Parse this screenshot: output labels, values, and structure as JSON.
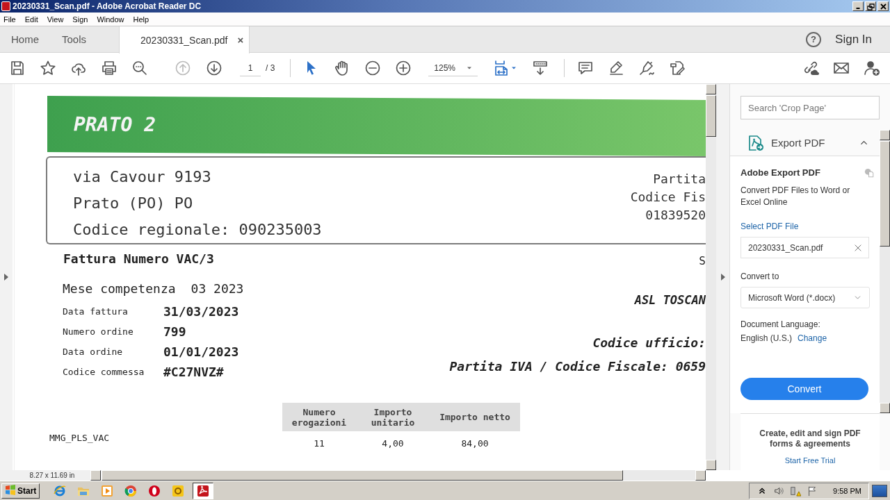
{
  "window": {
    "title": "20230331_Scan.pdf - Adobe Acrobat Reader DC"
  },
  "menu": [
    {
      "label": "File"
    },
    {
      "label": "Edit"
    },
    {
      "label": "View"
    },
    {
      "label": "Sign"
    },
    {
      "label": "Window"
    },
    {
      "label": "Help"
    }
  ],
  "tabs": [
    {
      "label": "Home",
      "selected": false
    },
    {
      "label": "Tools",
      "selected": false
    },
    {
      "label": "20230331_Scan.pdf",
      "selected": true,
      "close": "×"
    }
  ],
  "header_actions": {
    "help": "?",
    "sign_in": "Sign In"
  },
  "toolbar": {
    "navigation": [
      {
        "kind": "previous",
        "disabled": true
      },
      {
        "kind": "next",
        "disabled": false
      }
    ],
    "page_current": "1",
    "page_total": "/ 3",
    "pointer_tools": [
      {
        "kind": "select",
        "selected": true
      },
      {
        "kind": "hand",
        "selected": false
      }
    ],
    "zoom": "125%"
  },
  "document": {
    "header": "PRATO 2",
    "address_lines": [
      "via Cavour 9193",
      "Prato (PO) PO",
      "Codice regionale: 090235003"
    ],
    "right_lines": [
      "Partita",
      "Codice Fis",
      "01839520"
    ],
    "invoice": "Fattura Numero VAC/3",
    "invoice_right": "S",
    "period_label": "Mese competenza",
    "period_value": "03 2023",
    "recipient": "ASL TOSCAN",
    "details": [
      {
        "label": "Data fattura",
        "value": "31/03/2023"
      },
      {
        "label": "Numero ordine",
        "value": "799"
      },
      {
        "label": "Data ordine",
        "value": "01/01/2023"
      },
      {
        "label": "Codice commessa",
        "value": "#C27NVZ#"
      }
    ],
    "right_details": [
      "Codice ufficio:",
      "Partita IVA / Codice Fiscale: 0659"
    ],
    "table": {
      "columns": [
        "Numero erogazioni",
        "Importo unitario",
        "Importo netto"
      ],
      "rows": [
        {
          "service": "MMG_PLS_VAC",
          "cells": [
            "11",
            "4,00",
            "84,00"
          ]
        }
      ]
    }
  },
  "side_panel": {
    "search_placeholder": "Search 'Crop Page'",
    "section_title": "Export PDF",
    "expanded": true,
    "heading": "Adobe Export PDF",
    "description": "Convert PDF Files to Word or Excel Online",
    "select_link": "Select PDF File",
    "file_value": "20230331_Scan.pdf",
    "convert_label": "Convert to",
    "convert_value": "Microsoft Word (*.docx)",
    "language_label": "Document Language:",
    "language_value": "English (U.S.)",
    "change_link": "Change",
    "convert_button": "Convert",
    "promo": "Create, edit and sign PDF forms & agreements",
    "trial_link": "Start Free Trial"
  },
  "status_bar": {
    "page_size": "8.27 x 11.69 in"
  },
  "taskbar": {
    "start": "Start",
    "apps": [
      {
        "kind": "browser-e",
        "selected": false
      },
      {
        "kind": "folder",
        "selected": false
      },
      {
        "kind": "media",
        "selected": false
      },
      {
        "kind": "chrome",
        "selected": false
      },
      {
        "kind": "opera",
        "selected": false
      },
      {
        "kind": "outlook",
        "selected": false
      },
      {
        "kind": "acrobat",
        "selected": true
      }
    ],
    "clock": "9:58 PM"
  }
}
